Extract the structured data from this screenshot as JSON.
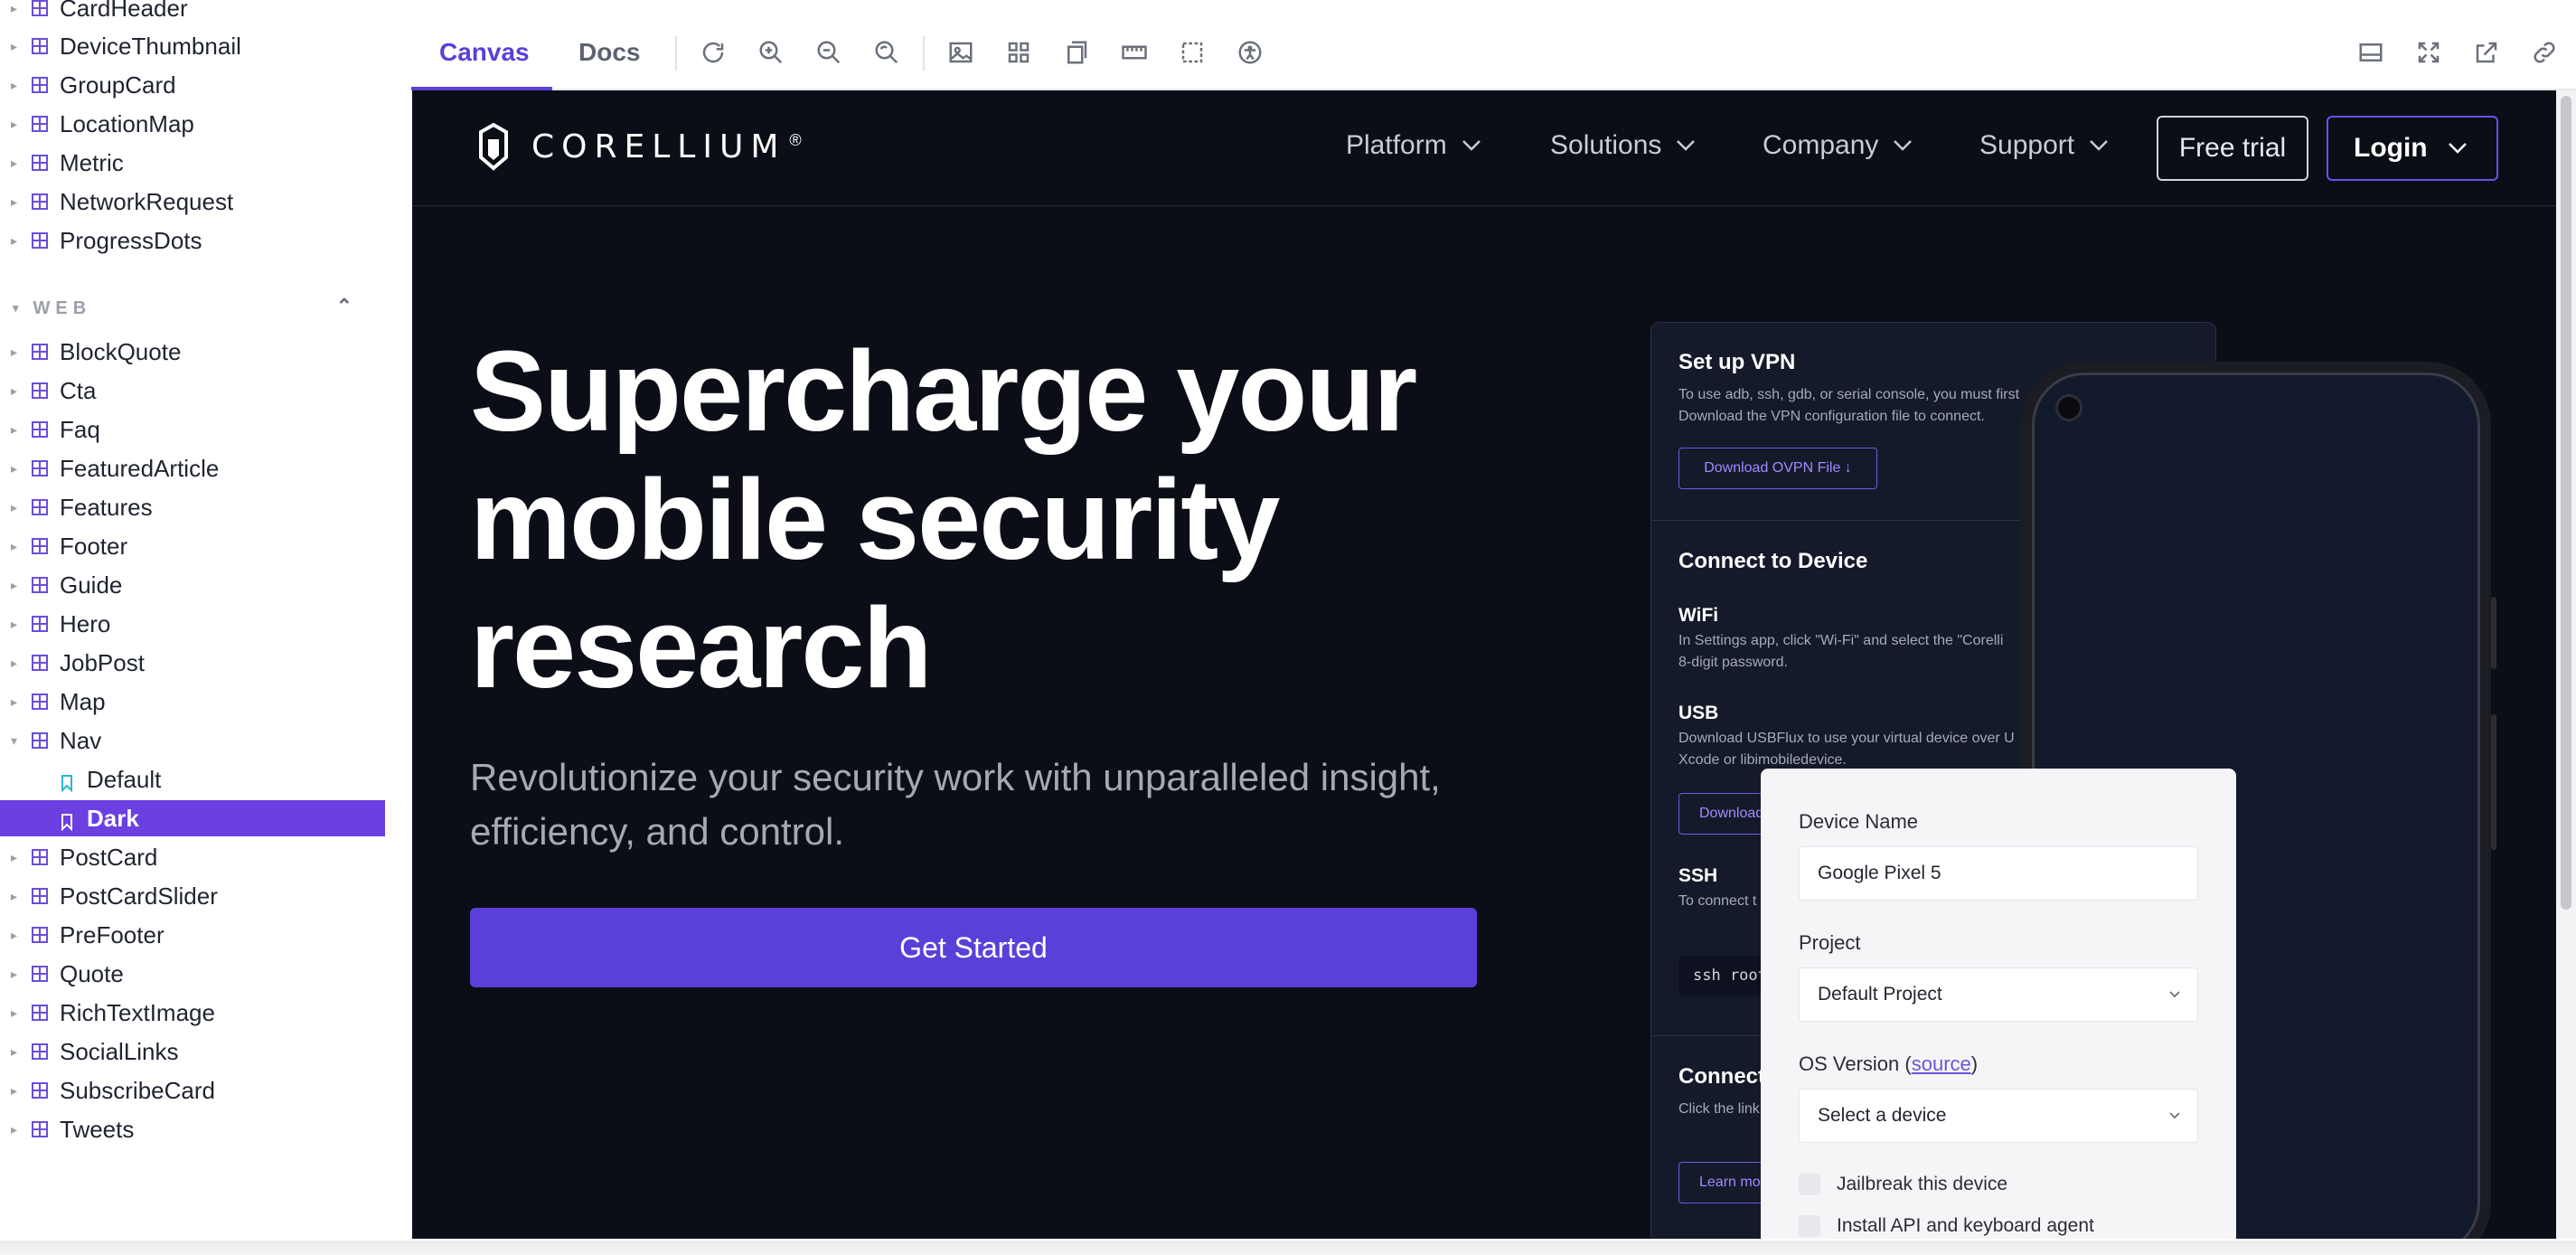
{
  "sidebar": {
    "items_top": [
      {
        "label": "CardHeader"
      },
      {
        "label": "DeviceThumbnail"
      },
      {
        "label": "GroupCard"
      },
      {
        "label": "LocationMap"
      },
      {
        "label": "Metric"
      },
      {
        "label": "NetworkRequest"
      },
      {
        "label": "ProgressDots"
      }
    ],
    "section": {
      "label": "WEB"
    },
    "items_web": [
      {
        "label": "BlockQuote"
      },
      {
        "label": "Cta"
      },
      {
        "label": "Faq"
      },
      {
        "label": "FeaturedArticle"
      },
      {
        "label": "Features"
      },
      {
        "label": "Footer"
      },
      {
        "label": "Guide"
      },
      {
        "label": "Hero"
      },
      {
        "label": "JobPost"
      },
      {
        "label": "Map"
      },
      {
        "label": "Nav"
      }
    ],
    "stories": [
      {
        "label": "Default"
      },
      {
        "label": "Dark"
      }
    ],
    "items_after": [
      {
        "label": "PostCard"
      },
      {
        "label": "PostCardSlider"
      },
      {
        "label": "PreFooter"
      },
      {
        "label": "Quote"
      },
      {
        "label": "RichTextImage"
      },
      {
        "label": "SocialLinks"
      },
      {
        "label": "SubscribeCard"
      },
      {
        "label": "Tweets"
      }
    ]
  },
  "toolbar": {
    "tabs": [
      {
        "label": "Canvas"
      },
      {
        "label": "Docs"
      }
    ],
    "tools": [
      "reload-icon",
      "zoom-in-icon",
      "zoom-out-icon",
      "zoom-reset-icon",
      "background-icon",
      "grid-icon",
      "measure-icon",
      "viewport-icon",
      "outline-icon",
      "accessibility-icon"
    ],
    "right_tools": [
      "panel-toggle-icon",
      "fullscreen-icon",
      "open-new-tab-icon",
      "copy-link-icon"
    ]
  },
  "nav": {
    "brand": "CORELLIUM",
    "brand_mark": "®",
    "links": [
      {
        "label": "Platform"
      },
      {
        "label": "Solutions"
      },
      {
        "label": "Company"
      },
      {
        "label": "Support"
      }
    ],
    "free_trial": "Free trial",
    "login": "Login"
  },
  "hero": {
    "title_lines": [
      "Supercharge your",
      "mobile security",
      "research"
    ],
    "subtitle_lines": [
      "Revolutionize your security work with unparalleled insight,",
      "efficiency, and control."
    ],
    "cta": "Get Started"
  },
  "panel": {
    "vpn_title": "Set up VPN",
    "vpn_text_1": "To use adb, ssh, gdb, or serial console, you must first",
    "vpn_text_2": "Download the VPN configuration file to connect.",
    "vpn_button": "Download OVPN File ↓",
    "connect_title": "Connect to Device",
    "wifi_title": "WiFi",
    "wifi_text_1": "In Settings app, click \"Wi-Fi\" and select the \"Corelli",
    "wifi_text_2": "8-digit password.",
    "usb_title": "USB",
    "usb_text_1": "Download USBFlux to use your virtual device over U",
    "usb_text_2": "Xcode or libimobiledevice.",
    "usb_button": "Download",
    "ssh_title": "SSH",
    "ssh_text": "To connect t",
    "ssh_code": "ssh root",
    "connect2_title": "Connect",
    "connect2_text": "Click the link",
    "learn_button": "Learn mo"
  },
  "form": {
    "device_name_label": "Device Name",
    "device_name_value": "Google Pixel 5",
    "project_label": "Project",
    "project_value": "Default Project",
    "os_label_prefix": "OS Version (",
    "os_label_link": "source",
    "os_label_suffix": ")",
    "os_value": "Select a device",
    "check_1": "Jailbreak this device",
    "check_2": "Install API and keyboard agent"
  }
}
